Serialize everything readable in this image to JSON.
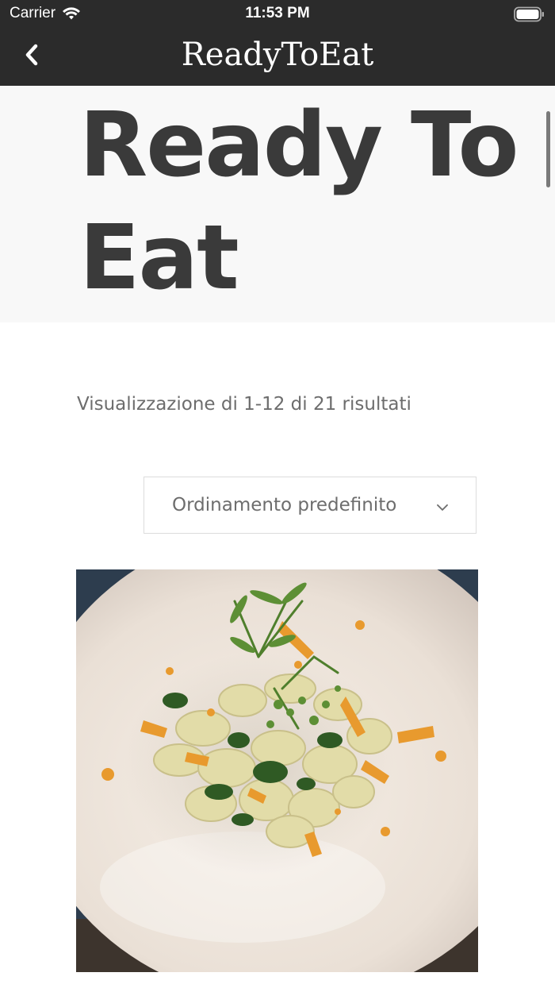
{
  "status_bar": {
    "carrier": "Carrier",
    "time": "11:53 PM",
    "icons": [
      "wifi-icon",
      "battery-icon"
    ]
  },
  "nav": {
    "title": "ReadyToEat",
    "back_icon": "back-chevron-icon"
  },
  "page": {
    "title": "Ready To Eat",
    "result_count": "Visualizzazione di 1-12 di 21 risultati"
  },
  "sort": {
    "selected": "Ordinamento predefinito",
    "icon": "chevron-down-icon"
  },
  "colors": {
    "nav_background": "#2b2b2b",
    "hero_background": "#f8f8f8",
    "title_text": "#3a3a3a",
    "muted_text": "#6d6d6d",
    "border": "#dcdcdc"
  },
  "products": [
    {
      "image": "pasta-dish-photo"
    }
  ]
}
